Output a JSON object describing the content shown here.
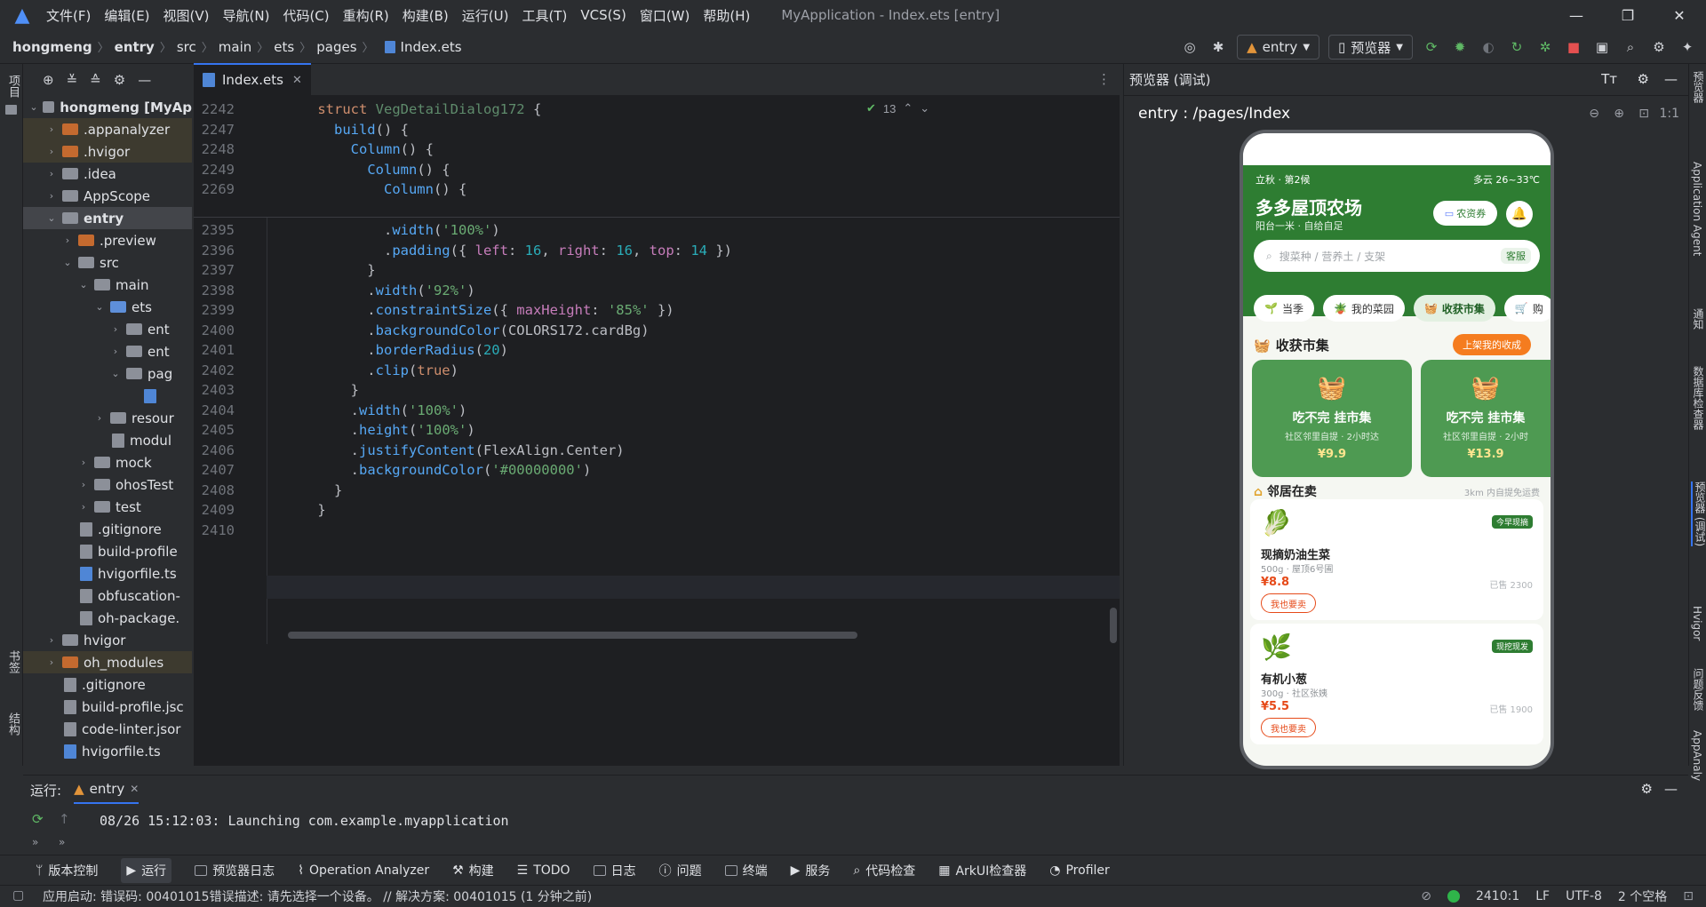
{
  "menubar": {
    "items": [
      "文件(F)",
      "编辑(E)",
      "视图(V)",
      "导航(N)",
      "代码(C)",
      "重构(R)",
      "构建(B)",
      "运行(U)",
      "工具(T)",
      "VCS(S)",
      "窗口(W)",
      "帮助(H)"
    ],
    "title": "MyApplication - Index.ets [entry]"
  },
  "breadcrumb": [
    "hongmeng",
    "entry",
    "src",
    "main",
    "ets",
    "pages",
    "Index.ets"
  ],
  "toolbar": {
    "config": "entry",
    "device": "预览器"
  },
  "left_strip": {
    "project": "项目",
    "bookmarks": "书签",
    "structure": "结构"
  },
  "project_tree": [
    {
      "label": "hongmeng [MyAp",
      "depth": 0,
      "kind": "folder"
    },
    {
      "label": ".appanalyzer",
      "depth": 1,
      "kind": "folder-orange"
    },
    {
      "label": ".hvigor",
      "depth": 1,
      "kind": "folder-orange"
    },
    {
      "label": ".idea",
      "depth": 1,
      "kind": "folder"
    },
    {
      "label": "AppScope",
      "depth": 1,
      "kind": "folder"
    },
    {
      "label": "entry",
      "depth": 1,
      "kind": "folder"
    },
    {
      "label": ".preview",
      "depth": 2,
      "kind": "folder-orange"
    },
    {
      "label": "src",
      "depth": 2,
      "kind": "folder"
    },
    {
      "label": "main",
      "depth": 3,
      "kind": "folder"
    },
    {
      "label": "ets",
      "depth": 4,
      "kind": "folder-blue"
    },
    {
      "label": "ent",
      "depth": 5,
      "kind": "folder"
    },
    {
      "label": "ent",
      "depth": 5,
      "kind": "folder"
    },
    {
      "label": "pag",
      "depth": 5,
      "kind": "folder"
    },
    {
      "label": "",
      "depth": 6,
      "kind": "file-blue"
    },
    {
      "label": "resour",
      "depth": 4,
      "kind": "folder"
    },
    {
      "label": "modul",
      "depth": 4,
      "kind": "file"
    },
    {
      "label": "mock",
      "depth": 3,
      "kind": "folder"
    },
    {
      "label": "ohosTest",
      "depth": 3,
      "kind": "folder"
    },
    {
      "label": "test",
      "depth": 3,
      "kind": "folder"
    },
    {
      "label": ".gitignore",
      "depth": 2,
      "kind": "file"
    },
    {
      "label": "build-profile",
      "depth": 2,
      "kind": "file"
    },
    {
      "label": "hvigorfile.ts",
      "depth": 2,
      "kind": "file-blue"
    },
    {
      "label": "obfuscation-",
      "depth": 2,
      "kind": "file"
    },
    {
      "label": "oh-package.",
      "depth": 2,
      "kind": "file"
    },
    {
      "label": "hvigor",
      "depth": 1,
      "kind": "folder"
    },
    {
      "label": "oh_modules",
      "depth": 1,
      "kind": "folder-orange"
    },
    {
      "label": ".gitignore",
      "depth": 1,
      "kind": "file"
    },
    {
      "label": "build-profile.jsc",
      "depth": 1,
      "kind": "file"
    },
    {
      "label": "code-linter.jsor",
      "depth": 1,
      "kind": "file"
    },
    {
      "label": "hvigorfile.ts",
      "depth": 1,
      "kind": "file-blue"
    }
  ],
  "editor": {
    "tab": "Index.ets",
    "inspection_count": "13",
    "sticky_lines": [
      {
        "n": "2242",
        "code": "struct VegDetailDialog172 {"
      },
      {
        "n": "2247",
        "code": "  build() {"
      },
      {
        "n": "2248",
        "code": "    Column() {"
      },
      {
        "n": "2249",
        "code": "      Column() {"
      },
      {
        "n": "2269",
        "code": "        Column() {"
      }
    ],
    "lines": [
      {
        "n": "2395",
        "code": "        .width('100%')"
      },
      {
        "n": "2396",
        "code": "        .padding({ left: 16, right: 16, top: 14 })"
      },
      {
        "n": "2397",
        "code": "      }"
      },
      {
        "n": "2398",
        "code": "      .width('92%')"
      },
      {
        "n": "2399",
        "code": "      .constraintSize({ maxHeight: '85%' })"
      },
      {
        "n": "2400",
        "code": "      .backgroundColor(COLORS172.cardBg)"
      },
      {
        "n": "2401",
        "code": "      .borderRadius(20)"
      },
      {
        "n": "2402",
        "code": "      .clip(true)"
      },
      {
        "n": "2403",
        "code": "    }"
      },
      {
        "n": "2404",
        "code": "    .width('100%')"
      },
      {
        "n": "2405",
        "code": "    .height('100%')"
      },
      {
        "n": "2406",
        "code": "    .justifyContent(FlexAlign.Center)"
      },
      {
        "n": "2407",
        "code": "    .backgroundColor('#00000000')"
      },
      {
        "n": "2408",
        "code": "  }"
      },
      {
        "n": "2409",
        "code": "}"
      },
      {
        "n": "2410",
        "code": ""
      }
    ]
  },
  "previewer": {
    "header": "预览器 (调试)",
    "route": "entry : /pages/Index",
    "zoom_label": "1:1",
    "app": {
      "season": "立秋 · 第2候",
      "weather": "多云 26~33℃",
      "farm_name": "多多屋顶农场",
      "farm_sub": "阳台一米 · 自给自足",
      "coupon": "农资券",
      "search_placeholder": "搜菜种 / 营养土 / 支架",
      "service": "客服",
      "categories": [
        "当季",
        "我的菜园",
        "收获市集",
        "购"
      ],
      "market_title": "收获市集",
      "market_action": "上架我的收成",
      "market_cards": [
        {
          "title": "吃不完 挂市集",
          "sub": "社区邻里自提 · 2小时达",
          "price": "¥9.9"
        },
        {
          "title": "吃不完 挂市集",
          "sub": "社区邻里自提 · 2小时",
          "price": "¥13.9"
        }
      ],
      "neighbors_title": "邻居在卖",
      "neighbors_hint": "3km 内自提免运费",
      "listings": [
        {
          "name": "现摘奶油生菜",
          "sub": "500g · 屋顶6号圃",
          "price": "¥8.8",
          "tag": "今早现摘",
          "sold": "已售 2300",
          "buy": "我也要卖"
        },
        {
          "name": "有机小葱",
          "sub": "300g · 社区张姨",
          "price": "¥5.5",
          "tag": "现挖现发",
          "sold": "已售 1900",
          "buy": "我也要卖"
        }
      ]
    }
  },
  "right_strip": [
    "预览器",
    "Application Agent",
    "通知",
    "数据库检查器",
    "预览器 (调试)",
    "Hvigor",
    "问题反馈",
    "AppAnaly"
  ],
  "run": {
    "label": "运行:",
    "tab": "entry",
    "log": "08/26 15:12:03: Launching com.example.myapplication"
  },
  "tool_windows": [
    "版本控制",
    "运行",
    "预览器日志",
    "Operation Analyzer",
    "构建",
    "TODO",
    "日志",
    "问题",
    "终端",
    "服务",
    "代码检查",
    "ArkUI检查器",
    "Profiler"
  ],
  "status": {
    "message": "应用启动: 错误码: 00401015错误描述: 请先选择一个设备。 // 解决方案: 00401015 (1 分钟之前)",
    "position": "2410:1",
    "line_sep": "LF",
    "encoding": "UTF-8",
    "indent": "2 个空格"
  }
}
